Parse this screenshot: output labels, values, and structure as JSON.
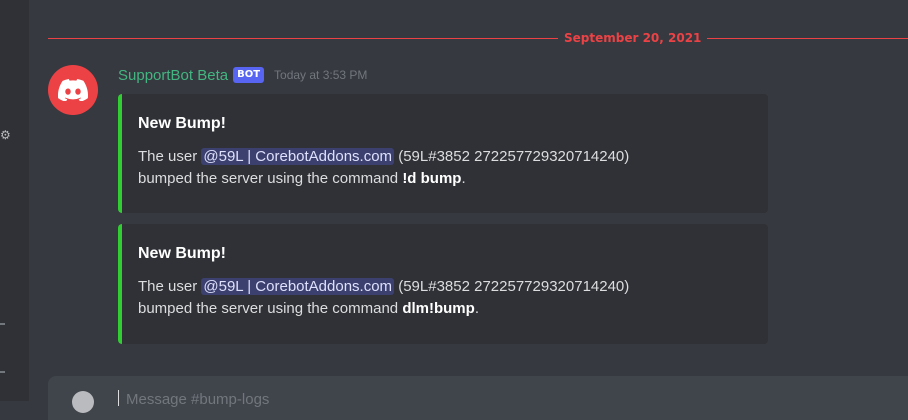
{
  "channel": {
    "date_divider": "September 20, 2021"
  },
  "message": {
    "author": "SupportBot Beta",
    "bot_tag": "BOT",
    "timestamp": "Today at 3:53 PM",
    "avatar_icon": "discord-logo-icon",
    "avatar_color": "#ed4245",
    "username_color": "#43b581"
  },
  "embeds": [
    {
      "title": "New Bump!",
      "desc_prefix": "The user ",
      "mention": "@59L | CorebotAddons.com",
      "desc_middle": " (59L#3852 272257729320714240)",
      "desc_line2": "bumped the server using the command ",
      "command": "!d bump",
      "desc_end": ".",
      "accent_color": "#32cd32"
    },
    {
      "title": "New Bump!",
      "desc_prefix": "The user ",
      "mention": "@59L | CorebotAddons.com",
      "desc_middle": " (59L#3852 272257729320714240)",
      "desc_line2": "bumped the server using the command ",
      "command": "dlm!bump",
      "desc_end": ".",
      "accent_color": "#32cd32"
    }
  ],
  "composer": {
    "placeholder": "Message #bump-logs"
  }
}
